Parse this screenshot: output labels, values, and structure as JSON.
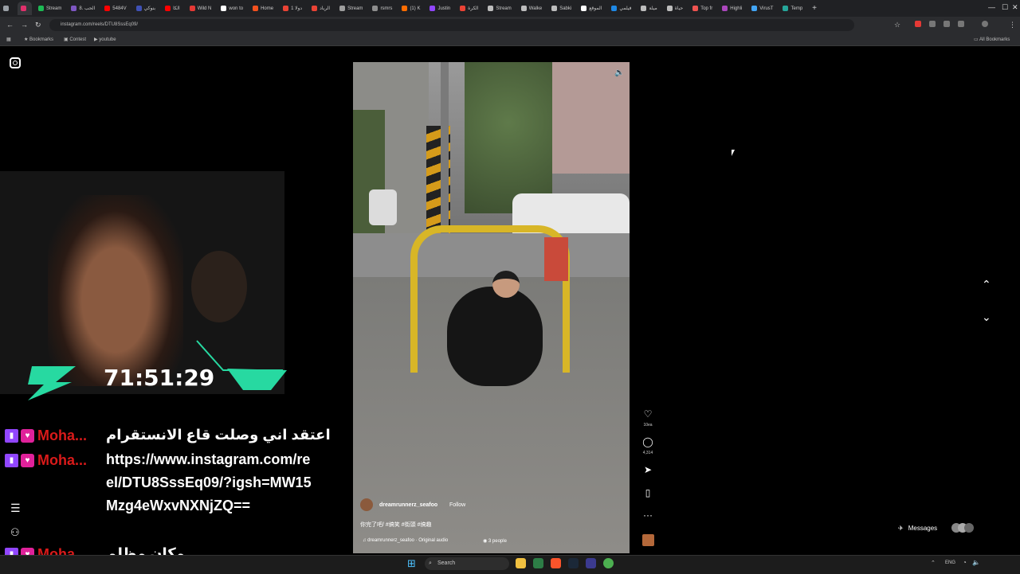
{
  "browser": {
    "tabs": [
      {
        "label": "",
        "color": "#9aa0a6"
      },
      {
        "label": "",
        "color": "#e1306c",
        "active": true
      },
      {
        "label": "Stream",
        "color": "#1db954"
      },
      {
        "label": "8. الحب",
        "color": "#7e57c2"
      },
      {
        "label": "5484V",
        "color": "#ff0000"
      },
      {
        "label": "بنوكي",
        "color": "#3f51b5"
      },
      {
        "label": "الكا",
        "color": "#ff0000"
      },
      {
        "label": "Wild N",
        "color": "#e53935"
      },
      {
        "label": "won to",
        "color": "#ffffff"
      },
      {
        "label": "Home",
        "color": "#f4511e"
      },
      {
        "label": "دولا 1",
        "color": "#ea4335"
      },
      {
        "label": "الرياد",
        "color": "#ea4335"
      },
      {
        "label": "Stream",
        "color": "#9e9e9e"
      },
      {
        "label": "rsmrs",
        "color": "#8e8e8e"
      },
      {
        "label": "(1) K",
        "color": "#ff6d00"
      },
      {
        "label": "Justin",
        "color": "#9146ff"
      },
      {
        "label": "الكرة",
        "color": "#ea4335"
      },
      {
        "label": "Stream",
        "color": "#bdbdbd"
      },
      {
        "label": "Walke",
        "color": "#bdbdbd"
      },
      {
        "label": "Sabki",
        "color": "#bdbdbd"
      },
      {
        "label": "الموقع",
        "color": "#ffffff"
      },
      {
        "label": "فيلمي",
        "color": "#1e88e5"
      },
      {
        "label": "ميلة",
        "color": "#bdbdbd"
      },
      {
        "label": "حياة",
        "color": "#bdbdbd"
      },
      {
        "label": "Top fr",
        "color": "#ef5350"
      },
      {
        "label": "Highli",
        "color": "#ab47bc"
      },
      {
        "label": "VirusT",
        "color": "#42a5f5"
      },
      {
        "label": "Temp",
        "color": "#26a69a"
      }
    ],
    "url": "instagram.com/reels/DTU8SssEq09/",
    "bookmarks": [
      "Bookmarks",
      "Contest",
      "youtube"
    ],
    "all_bookmarks": "All Bookmarks",
    "icons": [
      "back-icon",
      "forward-icon",
      "reload-icon",
      "star-icon",
      "extensions-icon",
      "profile-icon"
    ]
  },
  "instagram": {
    "logo": "instagram-icon",
    "reel": {
      "username": "dreamrunnerz_seafoo",
      "follow_label": "Follow",
      "caption": "你完了吧/ #搞笑 #街頭 #搞趣",
      "audio": "dreamrunnerz_seafoo · Original audio",
      "people": "3 people",
      "like_count": "10ea",
      "comment_count": "4,314",
      "mute_icon": "speaker-icon"
    },
    "messages_label": "Messages"
  },
  "overlay": {
    "timer": "71:51:29",
    "chat": [
      {
        "name": "Moha...",
        "message": "اعتقد اني وصلت قاع الانستقرام"
      },
      {
        "name": "Moha...",
        "message": "https://www.instagram.com/reel/DTU8SssEq09/?igsh=MW15Mzg4eWxvNXNjZQ=="
      },
      {
        "name": "Moha...",
        "message": "مكان مظلم"
      }
    ],
    "accent_color": "#27d9a1"
  },
  "taskbar": {
    "search_label": "Search",
    "system_text": "ENG"
  }
}
